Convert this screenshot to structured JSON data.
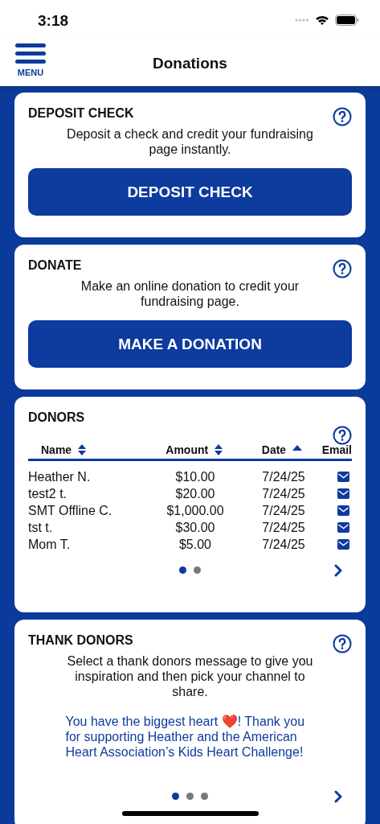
{
  "status_bar": {
    "time": "3:18"
  },
  "header": {
    "menu_label": "MENU",
    "title": "Donations"
  },
  "deposit": {
    "title": "DEPOSIT CHECK",
    "text": "Deposit a check and credit your fundraising page instantly.",
    "button": "DEPOSIT CHECK"
  },
  "donate": {
    "title": "DONATE",
    "text": "Make an online donation to credit your fundraising page.",
    "button": "MAKE A DONATION"
  },
  "donors": {
    "title": "DONORS",
    "columns": [
      {
        "label": "Name",
        "kind": "sortable"
      },
      {
        "label": "Amount",
        "kind": "sortable"
      },
      {
        "label": "Date",
        "kind": "ascending"
      },
      {
        "label": "Email",
        "kind": "plain"
      }
    ],
    "rows": [
      {
        "name": "Heather N.",
        "amount": "$10.00",
        "date": "7/24/25"
      },
      {
        "name": "test2 t.",
        "amount": "$20.00",
        "date": "7/24/25"
      },
      {
        "name": "SMT Offline C.",
        "amount": "$1,000.00",
        "date": "7/24/25"
      },
      {
        "name": "tst t.",
        "amount": "$30.00",
        "date": "7/24/25"
      },
      {
        "name": "Mom T.",
        "amount": "$5.00",
        "date": "7/24/25"
      }
    ],
    "pages": [
      {
        "selected": true
      },
      {
        "selected": false
      }
    ]
  },
  "thank": {
    "title": "THANK DONORS",
    "text": "Select a thank donors message to give you inspiration and then pick your channel to share.",
    "message": "You have the biggest heart ❤️! Thank you for supporting Heather and the American Heart Association’s Kids Heart Challenge!",
    "pages": [
      {
        "selected": true
      },
      {
        "selected": false
      },
      {
        "selected": false
      }
    ]
  }
}
